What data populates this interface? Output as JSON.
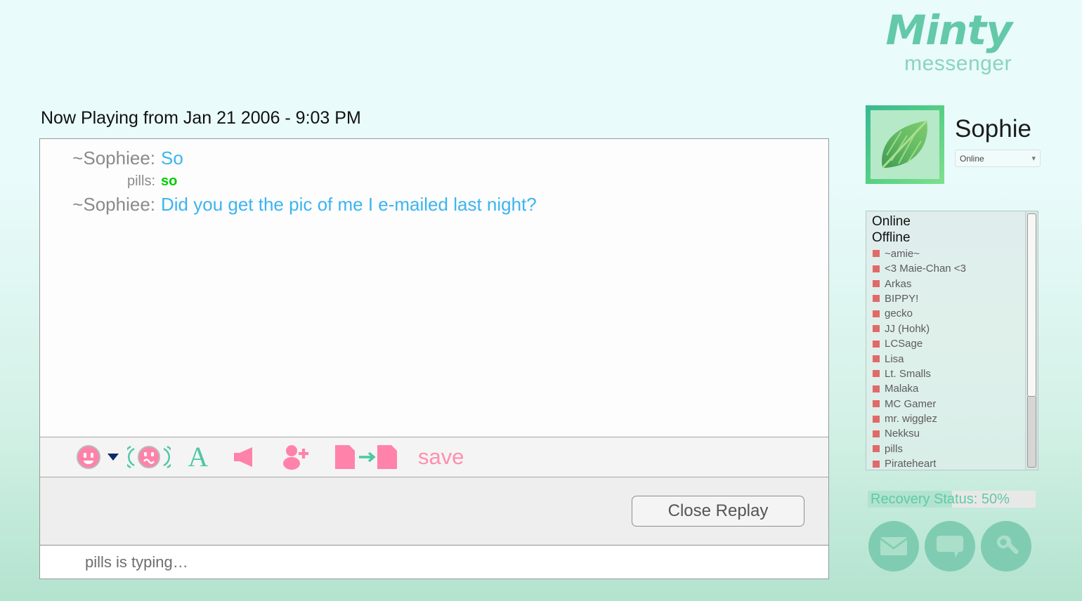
{
  "brand": {
    "name": "Minty",
    "subtitle": "messenger"
  },
  "profile": {
    "avatar_icon": "mint-leaf-icon",
    "name": "Sophie",
    "status_value": "Online",
    "status_options": [
      "Online",
      "Offline"
    ],
    "chevron": "chevron-down-icon"
  },
  "buddy_list": {
    "groups": [
      {
        "label": "Online",
        "contacts": []
      },
      {
        "label": "Offline",
        "contacts": [
          "~amie~",
          "<3 Maie-Chan <3",
          "Arkas",
          "BIPPY!",
          "gecko",
          "JJ (Hohk)",
          "LCSage",
          "Lisa",
          "Lt. Smalls",
          "Malaka",
          "MC Gamer",
          "mr. wigglez",
          "Nekksu",
          "pills",
          "Pirateheart"
        ]
      }
    ],
    "status_dot_color": "#e06a6a"
  },
  "recovery": {
    "label": "Recovery Status: 50%",
    "percent": 50,
    "fill_color": "#b2e3d0",
    "track_color": "#e8e8e8",
    "text_color": "#5ecaa6"
  },
  "round_buttons": [
    {
      "name": "mail-button",
      "icon": "envelope-icon"
    },
    {
      "name": "chat-button",
      "icon": "speech-bubble-icon"
    },
    {
      "name": "settings-button",
      "icon": "wrench-icon"
    }
  ],
  "chat": {
    "replay_title": "Now Playing from Jan 21 2006 - 9:03 PM",
    "messages": [
      {
        "sender": "~Sophiee:",
        "text": "So",
        "color": "#3cb4f0",
        "size": "lg",
        "bold": false
      },
      {
        "sender": "pills:",
        "text": "so",
        "color": "#00cc00",
        "size": "sm",
        "bold": true
      },
      {
        "sender": "~Sophiee:",
        "text": "Did you get the pic of me I e-mailed last night?",
        "color": "#3cb4f0",
        "size": "lg",
        "bold": false
      }
    ],
    "typing_status": "pills is typing…"
  },
  "toolbar": {
    "items": [
      {
        "name": "emoji-picker",
        "icon": "smiley-icon",
        "label": ""
      },
      {
        "name": "buzz-button",
        "icon": "buzz-smiley-icon",
        "label": ""
      },
      {
        "name": "font-button",
        "icon": "font-a-icon",
        "label": "A"
      },
      {
        "name": "sound-button",
        "icon": "speaker-icon",
        "label": ""
      },
      {
        "name": "invite-button",
        "icon": "add-person-icon",
        "label": ""
      },
      {
        "name": "send-file-button",
        "icon": "file-transfer-icon",
        "label": ""
      },
      {
        "name": "save-button",
        "icon": "",
        "label": "save"
      }
    ],
    "save_label": "save"
  },
  "actions": {
    "close_replay_label": "Close Replay"
  },
  "colors": {
    "brand_main": "#63c9a8",
    "brand_sub": "#8cd3bd",
    "accent_pink": "#ff8fb0",
    "accent_teal": "#4cc7a4"
  }
}
